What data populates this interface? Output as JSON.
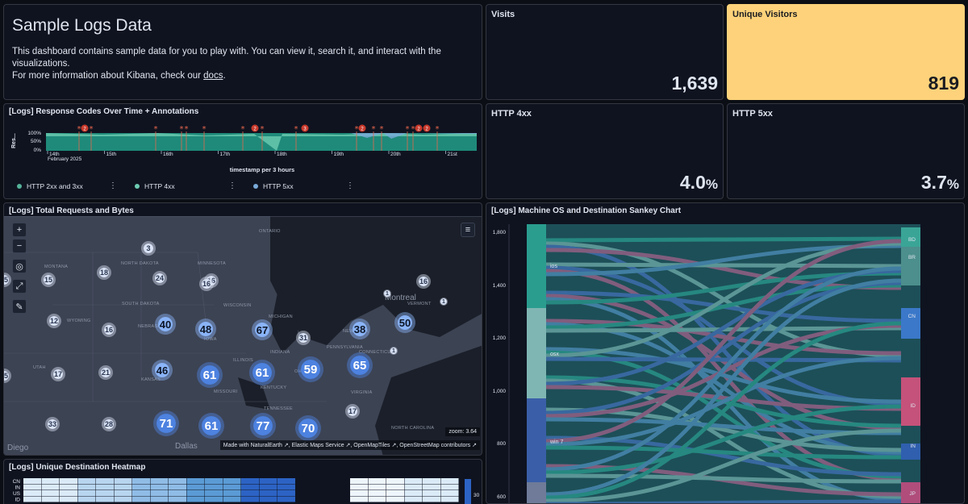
{
  "markdown": {
    "title": "Sample Logs Data",
    "text_line1": "This dashboard contains sample data for you to play with. You can view it, search it, and interact with the visualizations.",
    "text_line2_prefix": "For more information about Kibana, check our ",
    "docs_link": "docs",
    "text_line2_suffix": "."
  },
  "metrics": {
    "visits": {
      "title": "Visits",
      "value": "1,639"
    },
    "unique_visitors": {
      "title": "Unique Visitors",
      "value": "819",
      "bg": "#fdd27a"
    },
    "http4xx": {
      "title": "HTTP 4xx",
      "value": "4.0",
      "unit": "%"
    },
    "http5xx": {
      "title": "HTTP 5xx",
      "value": "3.7",
      "unit": "%"
    }
  },
  "response_codes": {
    "title": "[Logs] Response Codes Over Time + Annotations",
    "y_axis_label": "Res...",
    "y_ticks": [
      "100%",
      "50%",
      "0%"
    ],
    "x_ticks": [
      "14th",
      "15th",
      "16th",
      "17th",
      "18th",
      "19th",
      "20th",
      "21st"
    ],
    "x_sub": "February 2025",
    "x_title": "timestamp per 3 hours",
    "legend": [
      {
        "label": "HTTP 2xx and 3xx",
        "color": "#54b399"
      },
      {
        "label": "HTTP 4xx",
        "color": "#6dccb1"
      },
      {
        "label": "HTTP 5xx",
        "color": "#79aad9"
      }
    ],
    "annotation_badges": [
      "2",
      "2",
      "3",
      "2",
      "2",
      "2"
    ]
  },
  "map": {
    "title": "[Logs] Total Requests and Bytes",
    "zoom_label": "zoom: 3.64",
    "attribution": "Made with NaturalEarth ↗, Elastic Maps Service ↗, OpenMapTiles ↗, OpenStreetMap contributors ↗",
    "places": [
      "ONTARIO",
      "MONTANA",
      "NORTH DAKOTA",
      "MINNESOTA",
      "SOUTH DAKOTA",
      "WYOMING",
      "WISCONSIN",
      "MICHIGAN",
      "NEBRASKA",
      "IOWA",
      "UTAH",
      "ILLINOIS",
      "INDIANA",
      "OHIO",
      "PENNSYLVANIA",
      "NEW YORK",
      "VERMONT",
      "CONNECTICUT",
      "KENTUCKY",
      "VIRGINIA",
      "NORTH CAROLINA",
      "TENNESSEE",
      "MISSOURI",
      "KANSAS",
      "Montreal",
      "Dallas",
      "Diego"
    ],
    "clusters": [
      "3",
      "16",
      "18",
      "24",
      "16",
      "15",
      "40",
      "48",
      "67",
      "31",
      "38",
      "50",
      "12",
      "16",
      "46",
      "61",
      "61",
      "59",
      "65",
      "17",
      "21",
      "71",
      "61",
      "77",
      "70",
      "17",
      "33",
      "28",
      "1",
      "1",
      "1",
      "16",
      "15",
      "15"
    ]
  },
  "sankey": {
    "title": "[Logs] Machine OS and Destination Sankey Chart",
    "y_ticks": [
      "1,800",
      "1,400",
      "1,200",
      "1,000",
      "800",
      "600"
    ],
    "sources": [
      "ios",
      "osx",
      "win 7"
    ],
    "targets": [
      "BD",
      "BR",
      "CN",
      "ID",
      "IN",
      "JP"
    ]
  },
  "heatmap": {
    "title": "[Logs] Unique Destination Heatmap",
    "rows": [
      "CN",
      "IN",
      "US",
      "ID"
    ],
    "scale_max": "30"
  }
}
